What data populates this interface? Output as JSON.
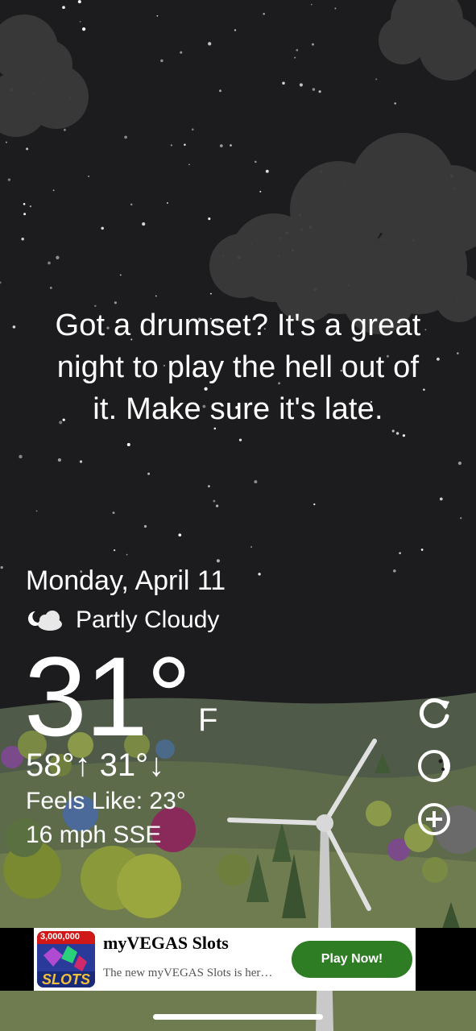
{
  "quote": {
    "line1": "Got a drumset? It's a great",
    "line2": "night to play the hell out of",
    "line3": "it. Make sure it's late."
  },
  "weather": {
    "date": "Monday, April 11",
    "condition": "Partly Cloudy",
    "condition_icon": "partly-cloudy-night-icon",
    "temperature": "31°",
    "unit": "F",
    "high": "58°",
    "high_arrow": "↑",
    "low": "31°",
    "low_arrow": "↓",
    "feels_like": "Feels Like: 23°",
    "wind": "16 mph SSE"
  },
  "side_buttons": [
    {
      "name": "refresh-icon"
    },
    {
      "name": "moon-phase-icon"
    },
    {
      "name": "add-icon"
    }
  ],
  "ad": {
    "badge": "3,000,000",
    "logo_text": "SLOTS",
    "title": "myVEGAS Slots",
    "description": "The new myVEGAS Slots is her…",
    "cta": "Play Now!"
  },
  "colors": {
    "sky": "#1c1c1e",
    "hills": "#6f7c4f",
    "cta_green": "#2e7d25"
  }
}
